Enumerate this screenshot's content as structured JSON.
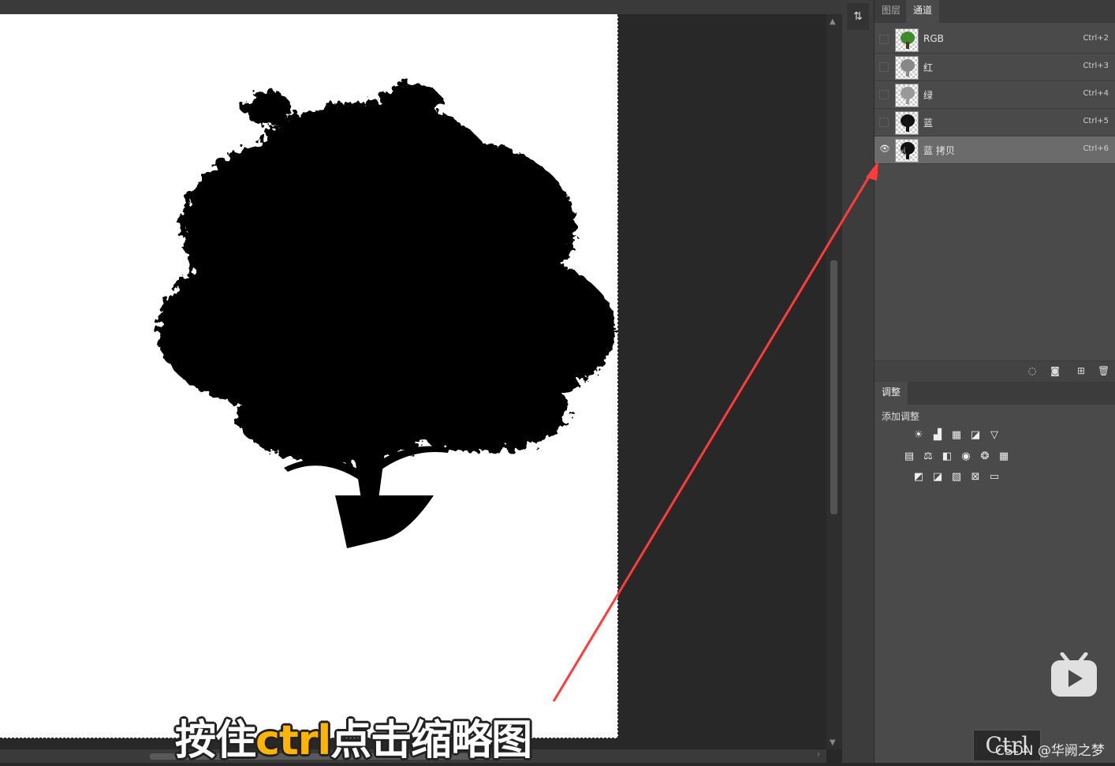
{
  "panel": {
    "tabs": [
      "图层",
      "通道"
    ],
    "active_tab": "通道",
    "channels": [
      {
        "name": "RGB",
        "shortcut": "Ctrl+2",
        "visible": false,
        "selected": false
      },
      {
        "name": "红",
        "shortcut": "Ctrl+3",
        "visible": false,
        "selected": false
      },
      {
        "name": "绿",
        "shortcut": "Ctrl+4",
        "visible": false,
        "selected": false
      },
      {
        "name": "蓝",
        "shortcut": "Ctrl+5",
        "visible": false,
        "selected": false
      },
      {
        "name": "蓝 拷贝",
        "shortcut": "Ctrl+6",
        "visible": true,
        "selected": true
      }
    ],
    "footer_icons": [
      "load-selection-icon",
      "save-mask-icon",
      "new-channel-icon",
      "delete-channel-icon"
    ]
  },
  "adjustments": {
    "tab": "调整",
    "add_label": "添加调整",
    "icon_rows": [
      [
        "brightness-icon",
        "levels-icon",
        "curves-icon",
        "exposure-icon",
        "vibrance-icon"
      ],
      [
        "hue-saturation-icon",
        "color-balance-icon",
        "black-white-icon",
        "photo-filter-icon",
        "channel-mixer-icon",
        "color-lookup-icon"
      ],
      [
        "invert-icon",
        "posterize-icon",
        "threshold-icon",
        "selective-color-icon",
        "gradient-map-icon"
      ]
    ]
  },
  "overlay": {
    "subtitle_pre": "按住",
    "subtitle_highlight": "ctrl",
    "subtitle_post": "点击缩略图",
    "key_caption": "Ctrl",
    "watermark": "CSDN @华阙之梦",
    "highlight_color": "#ffb400",
    "arrow_color": "#ff3b3b"
  }
}
